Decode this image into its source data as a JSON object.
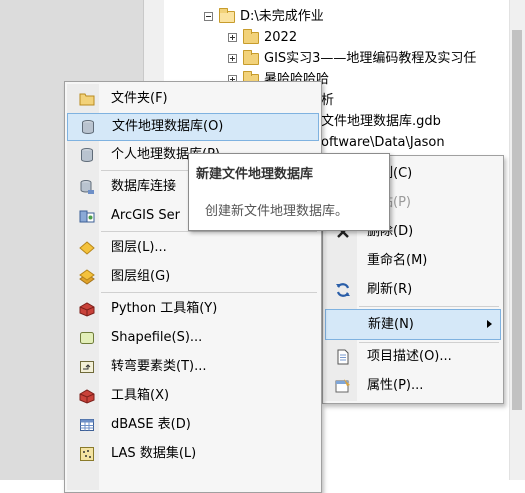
{
  "tree": {
    "items": [
      {
        "label": "D:\\未完成作业",
        "expander": "minus",
        "icon": "folder-open-icon"
      },
      {
        "label": "2022",
        "expander": "plus",
        "icon": "folder-icon"
      },
      {
        "label": "GIS实习3——地理编码教程及实习任",
        "expander": "plus",
        "icon": "folder-icon"
      },
      {
        "label": "暑哈哈哈哈",
        "expander": "plus",
        "icon": "folder-icon"
      }
    ],
    "partial_1": "析",
    "partial_2": "文件地理数据库.gdb",
    "partial_3": "oftware\\Data\\Jason"
  },
  "new_menu": {
    "items": [
      {
        "label": "文件夹(F)",
        "icon": "folder-icon"
      },
      {
        "label": "文件地理数据库(O)",
        "icon": "file-geodatabase-icon"
      },
      {
        "label": "个人地理数据库(P)",
        "icon": "personal-geodatabase-icon"
      },
      {
        "label": "数据库连接",
        "icon": "database-connection-icon"
      },
      {
        "label": "ArcGIS Ser",
        "icon": "arcgis-server-icon"
      },
      {
        "label": "图层(L)...",
        "icon": "layer-icon"
      },
      {
        "label": "图层组(G)",
        "icon": "group-layer-icon"
      },
      {
        "label": "Python 工具箱(Y)",
        "icon": "python-toolbox-icon"
      },
      {
        "label": "Shapefile(S)...",
        "icon": "shapefile-icon"
      },
      {
        "label": "转弯要素类(T)...",
        "icon": "turn-feature-class-icon"
      },
      {
        "label": "工具箱(X)",
        "icon": "toolbox-icon"
      },
      {
        "label": "dBASE 表(D)",
        "icon": "dbase-table-icon"
      },
      {
        "label": "LAS 数据集(L)",
        "icon": "las-dataset-icon"
      }
    ]
  },
  "context_menu": {
    "items": [
      {
        "label": "复制(C)",
        "icon": "copy-icon"
      },
      {
        "label": "粘贴(P)",
        "icon": "paste-icon"
      },
      {
        "label": "删除(D)",
        "icon": "delete-icon"
      },
      {
        "label": "重命名(M)",
        "icon": ""
      },
      {
        "label": "刷新(R)",
        "icon": "refresh-icon"
      },
      {
        "label": "新建(N)",
        "icon": ""
      },
      {
        "label": "项目描述(O)...",
        "icon": "item-description-icon"
      },
      {
        "label": "属性(P)...",
        "icon": "properties-icon"
      }
    ]
  },
  "tooltip": {
    "title": "新建文件地理数据库",
    "body": "创建新文件地理数据库。"
  },
  "colors": {
    "highlight": "#d5e8f8",
    "highlight_border": "#7fb2e0",
    "menu_bg": "#f6f6f6",
    "folder": "#f2d27a"
  }
}
